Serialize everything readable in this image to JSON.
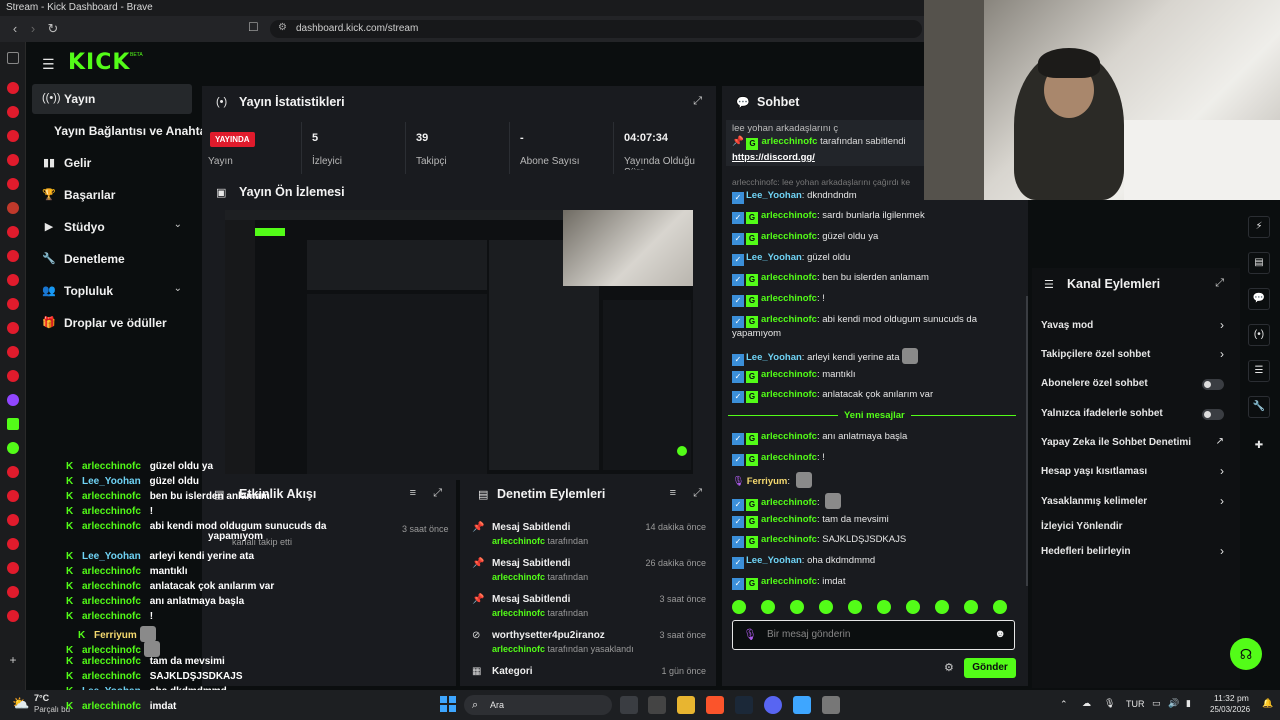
{
  "browser": {
    "window_title": "Stream - Kick Dashboard - Brave",
    "url": "dashboard.kick.com/stream"
  },
  "logo": {
    "text": "KICK",
    "beta": "BETA"
  },
  "nav": {
    "items": [
      {
        "label": "Yayın",
        "icon": "broadcast-icon"
      },
      {
        "label": "Yayın Bağlantısı ve Anahtarı"
      },
      {
        "label": "Gelir",
        "icon": "bar-chart-icon"
      },
      {
        "label": "Başarılar",
        "icon": "trophy-icon"
      },
      {
        "label": "Stüdyo",
        "icon": "video-icon"
      },
      {
        "label": "Denetleme",
        "icon": "wrench-icon"
      },
      {
        "label": "Topluluk",
        "icon": "users-icon"
      },
      {
        "label": "Droplar ve ödüller",
        "icon": "gift-icon"
      }
    ]
  },
  "stats": {
    "title": "Yayın İstatistikleri",
    "live_badge": "YAYINDA",
    "items": [
      {
        "value": "",
        "label": "Yayın"
      },
      {
        "value": "5",
        "label": "İzleyici"
      },
      {
        "value": "39",
        "label": "Takipçi"
      },
      {
        "value": "-",
        "label": "Abone Sayısı"
      },
      {
        "value": "04:07:34",
        "label": "Yayında Olduğu Süre"
      }
    ]
  },
  "preview": {
    "title": "Yayın Ön İzlemesi"
  },
  "activity": {
    "title": "Etkinlik Akışı",
    "events": [
      {
        "text": "kanalı takip etti",
        "time": "3 saat önce"
      }
    ]
  },
  "moderation": {
    "title": "Denetim Eylemleri",
    "items": [
      {
        "title": "Mesaj Sabitlendi",
        "user": "arlecchinofc",
        "suffix": "tarafından",
        "time": "14 dakika önce"
      },
      {
        "title": "Mesaj Sabitlendi",
        "user": "arlecchinofc",
        "suffix": "tarafından",
        "time": "26 dakika önce"
      },
      {
        "title": "Mesaj Sabitlendi",
        "user": "arlecchinofc",
        "suffix": "tarafından",
        "time": "3 saat önce"
      },
      {
        "title": "worthysetter4pu2iranoz",
        "user": "arlecchinofc",
        "suffix": "tarafından yasaklandı",
        "time": "3 saat önce"
      },
      {
        "title": "Kategori",
        "user": "",
        "suffix": "",
        "time": "1 gün önce"
      }
    ]
  },
  "chat": {
    "title": "Sohbet",
    "pinned_header": "lee yohan arkadaşlarını ç",
    "pinned_by_user": "arlecchinofc",
    "pinned_by_suffix": "tarafından sabitlendi",
    "pinned_link": "https://discord.gg/",
    "reply_preview": "arlecchinofc: lee yohan arkadaşlarını çağırdı ke",
    "new_messages": "Yeni mesajlar",
    "input_placeholder": "Bir mesaj gönderin",
    "send": "Gönder",
    "messages": [
      {
        "user": "Lee_Yoohan",
        "color": "#6fd3f5",
        "text": "dkndndndm"
      },
      {
        "user": "arlecchinofc",
        "color": "#53fc18",
        "text": "sardı bunlarla ilgilenmek"
      },
      {
        "user": "arlecchinofc",
        "color": "#53fc18",
        "text": "güzel oldu ya"
      },
      {
        "user": "Lee_Yoohan",
        "color": "#6fd3f5",
        "text": "güzel oldu"
      },
      {
        "user": "arlecchinofc",
        "color": "#53fc18",
        "text": "ben bu islerden anlamam"
      },
      {
        "user": "arlecchinofc",
        "color": "#53fc18",
        "text": "!"
      },
      {
        "user": "arlecchinofc",
        "color": "#53fc18",
        "text": "abi kendi mod oldugum sunucuds da"
      },
      {
        "user": "",
        "color": "#53fc18",
        "text": "yapamıyom"
      },
      {
        "user": "Lee_Yoohan",
        "color": "#6fd3f5",
        "text": "arleyi kendi yerine ata"
      },
      {
        "user": "arlecchinofc",
        "color": "#53fc18",
        "text": "mantıklı"
      },
      {
        "user": "arlecchinofc",
        "color": "#53fc18",
        "text": "anlatacak çok anılarım var"
      },
      {
        "user": "arlecchinofc",
        "color": "#53fc18",
        "text": "anı anlatmaya başla"
      },
      {
        "user": "arlecchinofc",
        "color": "#53fc18",
        "text": "!"
      },
      {
        "user": "Ferriyum",
        "color": "#f5d96f",
        "text": ""
      },
      {
        "user": "arlecchinofc",
        "color": "#53fc18",
        "text": ""
      },
      {
        "user": "arlecchinofc",
        "color": "#53fc18",
        "text": "tam da mevsimi"
      },
      {
        "user": "arlecchinofc",
        "color": "#53fc18",
        "text": "SAJKLDŞJSDKAJS"
      },
      {
        "user": "Lee_Yoohan",
        "color": "#6fd3f5",
        "text": "oha dkdmdmmd"
      },
      {
        "user": "arlecchinofc",
        "color": "#53fc18",
        "text": "imdat"
      }
    ]
  },
  "actions": {
    "title": "Kanal Eylemleri",
    "items": [
      {
        "label": "Yavaş mod",
        "control": "chevron"
      },
      {
        "label": "Takipçilere özel sohbet",
        "control": "chevron"
      },
      {
        "label": "Abonelere özel sohbet",
        "control": "toggle"
      },
      {
        "label": "Yalnızca ifadelerle sohbet",
        "control": "toggle"
      },
      {
        "label": "Yapay Zeka ile Sohbet Denetimi",
        "control": "external"
      },
      {
        "label": "Hesap yaşı kısıtlaması",
        "control": "chevron"
      },
      {
        "label": "Yasaklanmış kelimeler",
        "control": "chevron"
      },
      {
        "label": "İzleyici Yönlendir",
        "control": "none"
      },
      {
        "label": "Hedefleri belirleyin",
        "control": "chevron"
      }
    ]
  },
  "overlay_chat": [
    {
      "user": "arlecchinofc",
      "text": "güzel oldu ya"
    },
    {
      "user": "Lee_Yoohan",
      "text": "güzel oldu"
    },
    {
      "user": "arlecchinofc",
      "text": "ben bu islerden anlamam"
    },
    {
      "user": "arlecchinofc",
      "text": "!"
    },
    {
      "user": "arlecchinofc",
      "text": "abi kendi mod oldugum sunucuds da"
    },
    {
      "user": "",
      "text": "yapamıyom"
    },
    {
      "user": "Lee_Yoohan",
      "text": "arleyi kendi yerine ata"
    },
    {
      "user": "arlecchinofc",
      "text": "mantıklı"
    },
    {
      "user": "arlecchinofc",
      "text": "anlatacak çok anılarım var"
    },
    {
      "user": "arlecchinofc",
      "text": "anı anlatmaya başla"
    },
    {
      "user": "arlecchinofc",
      "text": "!"
    },
    {
      "user": "Ferriyum",
      "text": ""
    },
    {
      "user": "arlecchinofc",
      "text": ""
    },
    {
      "user": "arlecchinofc",
      "text": "tam da mevsimi"
    },
    {
      "user": "arlecchinofc",
      "text": "SAJKLDŞJSDKAJS"
    },
    {
      "user": "Lee_Yoohan",
      "text": "oha dkdmdmmd"
    },
    {
      "user": "arlecchinofc",
      "text": "imdat"
    }
  ],
  "taskbar": {
    "weather_temp": "7°C",
    "weather_text": "Parçalı bu",
    "search": "Ara",
    "lang": "TUR",
    "time": "11:32 pm",
    "date": "25/03/2026"
  },
  "colors": {
    "brand": "#53fc18",
    "live": "#e01b2c",
    "panel": "#191b1f",
    "bg": "#0b0e0f"
  }
}
